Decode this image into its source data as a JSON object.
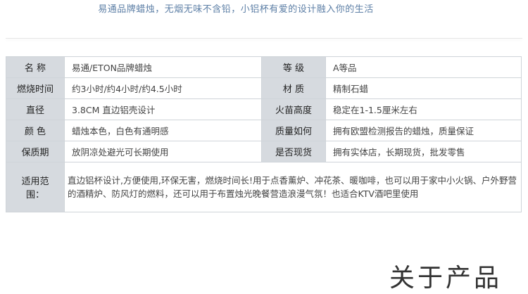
{
  "tagline": "易通品牌蜡烛，无烟无味不含铅，小铝杯有爱的设计融入你的生活",
  "specs": [
    {
      "label_left": "名  称",
      "value_left": "易通/ETON品牌蜡烛",
      "label_right": "等  级",
      "value_right": "A等品"
    },
    {
      "label_left": "燃烧时间",
      "value_left": "约3小时/约4小时/约4.5小时",
      "label_right": "材  质",
      "value_right": "精制石蜡"
    },
    {
      "label_left": "直径",
      "value_left": "3.8CM 直边铝壳设计",
      "label_right": "火苗高度",
      "value_right": "稳定在1-1.5厘米左右"
    },
    {
      "label_left": "颜  色",
      "value_left": "蜡烛本色，白色有通明感",
      "label_right": "质量如何",
      "value_right": "拥有欧盟检测报告的蜡烛，质量保证"
    },
    {
      "label_left": "保质期",
      "value_left": "放阴凉处避光可长期使用",
      "label_right": "是否现货",
      "value_right": "拥有实体店，长期现货，批发零售"
    }
  ],
  "scope": {
    "label": "适用范围：",
    "value": "直边铝杯设计,方便使用,环保无害，燃烧时间长!用于点香薰炉、冲花茶、暖咖啡，也可以用于家中小火锅、户外野营的酒精炉、防风灯的燃料，还可以用于布置烛光晚餐营造浪漫气氛！也适合KTV酒吧里使用"
  },
  "section_heading": "关于产品"
}
